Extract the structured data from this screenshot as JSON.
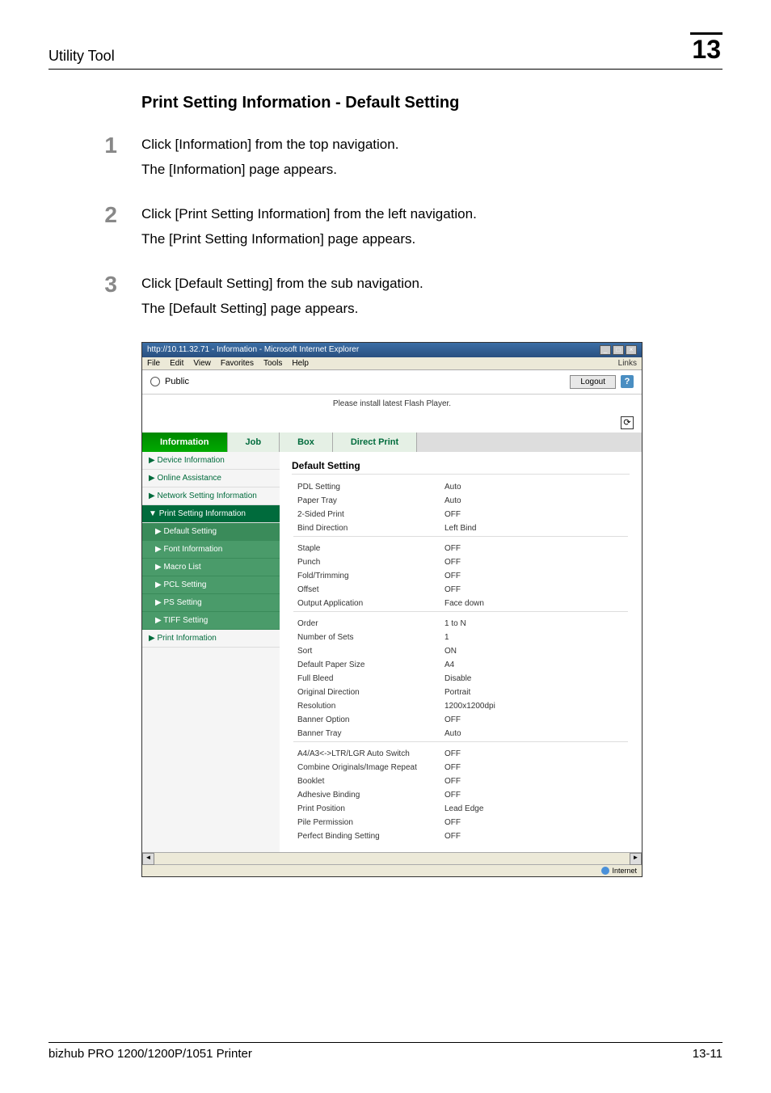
{
  "header": {
    "title": "Utility Tool",
    "chapter_number": "13"
  },
  "section_title": "Print Setting Information - Default Setting",
  "steps": [
    {
      "number": "1",
      "line1": "Click [Information] from the top navigation.",
      "line2": "The [Information] page appears."
    },
    {
      "number": "2",
      "line1": "Click [Print Setting Information] from the left navigation.",
      "line2": "The [Print Setting Information] page appears."
    },
    {
      "number": "3",
      "line1": "Click [Default Setting] from the sub navigation.",
      "line2": "The [Default Setting] page appears."
    }
  ],
  "browser": {
    "title": "http://10.11.32.71 - Information - Microsoft Internet Explorer",
    "menu": [
      "File",
      "Edit",
      "View",
      "Favorites",
      "Tools",
      "Help"
    ],
    "links_label": "Links",
    "user": "Public",
    "logout": "Logout",
    "flash_message": "Please install latest Flash Player.",
    "tabs": [
      "Information",
      "Job",
      "Box",
      "Direct Print"
    ],
    "sidebar": [
      {
        "label": "Device Information",
        "type": "item"
      },
      {
        "label": "Online Assistance",
        "type": "item"
      },
      {
        "label": "Network Setting Information",
        "type": "item"
      },
      {
        "label": "Print Setting Information",
        "type": "active-parent"
      },
      {
        "label": "Default Setting",
        "type": "subitem-active"
      },
      {
        "label": "Font Information",
        "type": "subitem"
      },
      {
        "label": "Macro List",
        "type": "subitem"
      },
      {
        "label": "PCL Setting",
        "type": "subitem"
      },
      {
        "label": "PS Setting",
        "type": "subitem"
      },
      {
        "label": "TIFF Setting",
        "type": "subitem"
      },
      {
        "label": "Print Information",
        "type": "item"
      }
    ],
    "content_title": "Default Setting",
    "settings_groups": [
      [
        {
          "label": "PDL Setting",
          "value": "Auto"
        },
        {
          "label": "Paper Tray",
          "value": "Auto"
        },
        {
          "label": "2-Sided Print",
          "value": "OFF"
        },
        {
          "label": "Bind Direction",
          "value": "Left Bind"
        }
      ],
      [
        {
          "label": "Staple",
          "value": "OFF"
        },
        {
          "label": "Punch",
          "value": "OFF"
        },
        {
          "label": "Fold/Trimming",
          "value": "OFF"
        },
        {
          "label": "Offset",
          "value": "OFF"
        },
        {
          "label": "Output Application",
          "value": "Face down"
        }
      ],
      [
        {
          "label": "Order",
          "value": "1 to N"
        },
        {
          "label": "Number of Sets",
          "value": "1"
        },
        {
          "label": "Sort",
          "value": "ON"
        },
        {
          "label": "Default Paper Size",
          "value": "A4"
        },
        {
          "label": "Full Bleed",
          "value": "Disable"
        },
        {
          "label": "Original Direction",
          "value": "Portrait"
        },
        {
          "label": "Resolution",
          "value": "1200x1200dpi"
        },
        {
          "label": "Banner Option",
          "value": "OFF"
        },
        {
          "label": "Banner Tray",
          "value": "Auto"
        }
      ],
      [
        {
          "label": "A4/A3<->LTR/LGR Auto Switch",
          "value": "OFF"
        },
        {
          "label": "Combine Originals/Image Repeat",
          "value": "OFF"
        },
        {
          "label": "Booklet",
          "value": "OFF"
        },
        {
          "label": "Adhesive Binding",
          "value": "OFF"
        },
        {
          "label": "Print Position",
          "value": "Lead Edge"
        },
        {
          "label": "Pile Permission",
          "value": "OFF"
        },
        {
          "label": "Perfect Binding Setting",
          "value": "OFF"
        }
      ]
    ],
    "status_text": "Internet"
  },
  "footer": {
    "left": "bizhub PRO 1200/1200P/1051 Printer",
    "right": "13-11"
  }
}
